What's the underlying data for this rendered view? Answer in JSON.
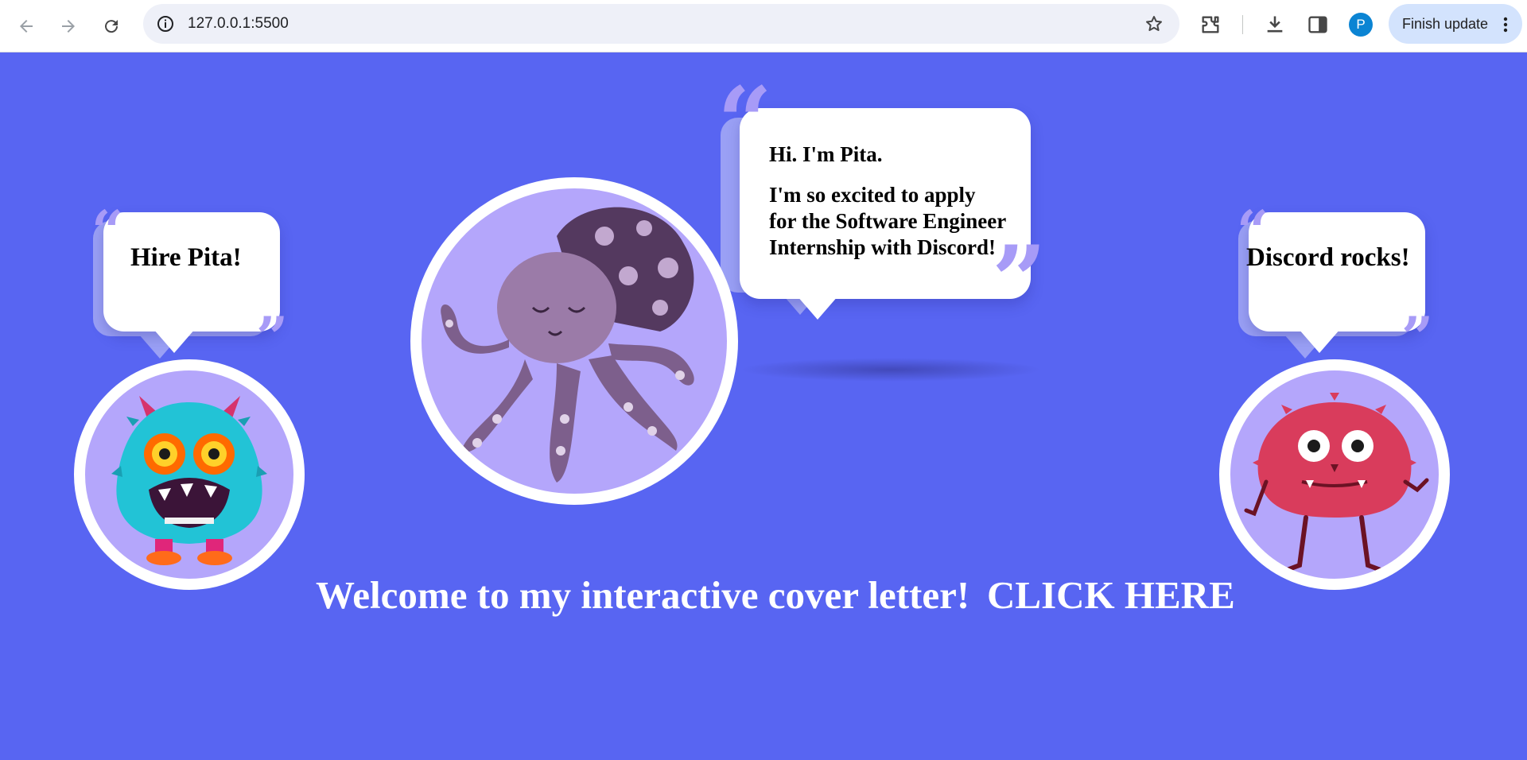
{
  "browser": {
    "url": "127.0.0.1:5500",
    "update_label": "Finish update",
    "profile_initial": "P",
    "icons": [
      "back-arrow-icon",
      "forward-arrow-icon",
      "reload-icon",
      "site-info-icon",
      "bookmark-star-icon",
      "extensions-icon",
      "download-icon",
      "side-panel-icon",
      "kebab-menu-icon"
    ]
  },
  "page": {
    "background_color": "#5865f2",
    "accent_color": "#b4a6fb",
    "left_bubble": {
      "text": "Hire Pita!"
    },
    "center_bubble": {
      "line1": "Hi. I'm Pita.",
      "line2": "I'm so excited to apply for the Software Engineer Internship with Discord!"
    },
    "right_bubble": {
      "text": "Discord rocks!"
    },
    "welcome_text": "Welcome to my interactive cover letter!",
    "cta_text": "CLICK HERE",
    "portraits": [
      "blue-monster",
      "purple-octopus",
      "red-monster"
    ]
  }
}
